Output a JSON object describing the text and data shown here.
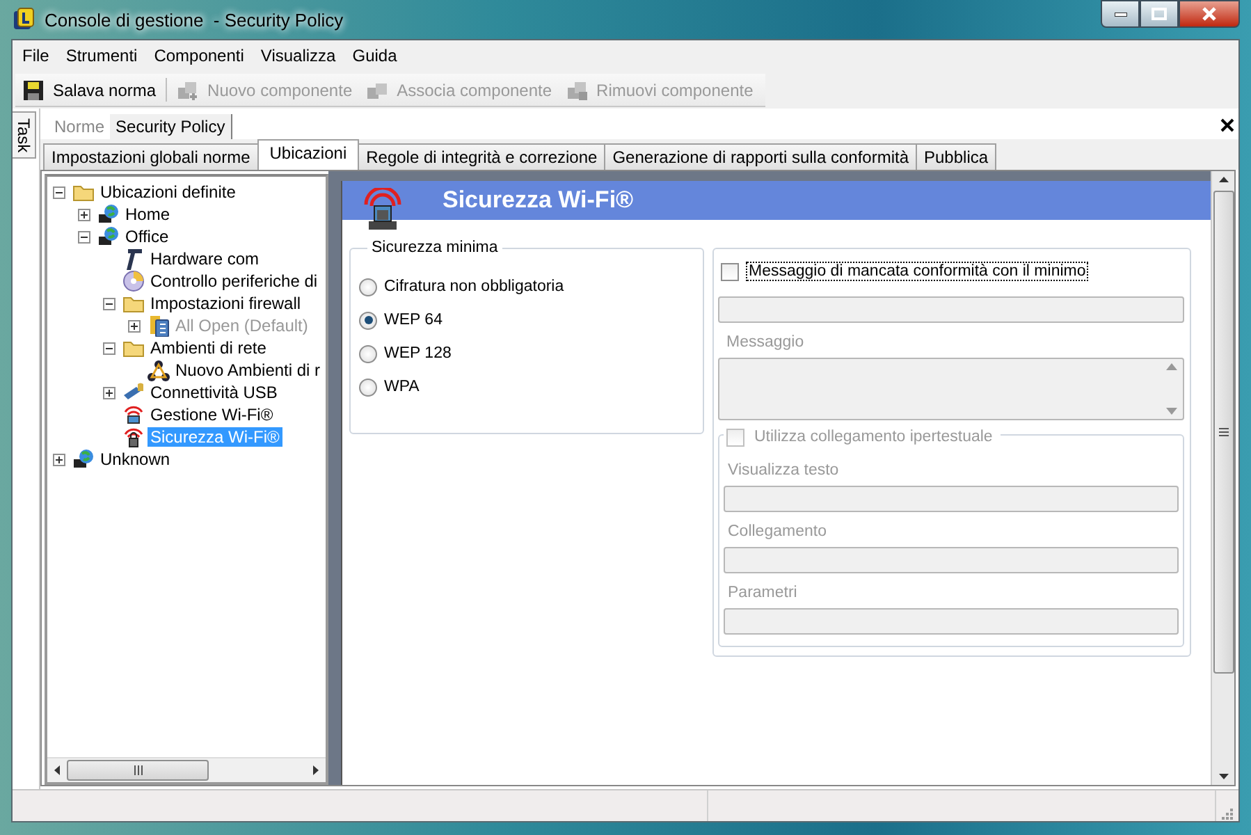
{
  "window": {
    "title": "Console di gestione  - Security Policy"
  },
  "menu": [
    "File",
    "Strumenti",
    "Componenti",
    "Visualizza",
    "Guida"
  ],
  "toolbar": [
    {
      "kind": "save",
      "label": "Salava norma",
      "disabled": false
    },
    {
      "kind": "new",
      "label": "Nuovo componente",
      "disabled": true
    },
    {
      "kind": "link",
      "label": "Associa componente",
      "disabled": true
    },
    {
      "kind": "remove",
      "label": "Rimuovi componente",
      "disabled": true
    }
  ],
  "side_tab": "Task",
  "doc_tabs": [
    {
      "label": "Norme",
      "selected": false
    },
    {
      "label": "Security Policy",
      "selected": true
    }
  ],
  "tabs": [
    {
      "label": "Impostazioni globali norme",
      "selected": false
    },
    {
      "label": "Ubicazioni",
      "selected": true
    },
    {
      "label": "Regole di integrità e correzione",
      "selected": false
    },
    {
      "label": "Generazione di rapporti sulla conformità",
      "selected": false
    },
    {
      "label": "Pubblica",
      "selected": false
    }
  ],
  "tree": [
    {
      "label": "Ubicazioni definite",
      "kind": "folder",
      "expanded": true,
      "selected": false,
      "disabled": false,
      "children": [
        {
          "label": "Home",
          "kind": "globe",
          "expanded": false,
          "selected": false,
          "disabled": false
        },
        {
          "label": "Office",
          "kind": "globe",
          "expanded": true,
          "selected": false,
          "disabled": false,
          "children": [
            {
              "label": "Hardware com",
              "kind": "hardware",
              "selected": false,
              "disabled": false
            },
            {
              "label": "Controllo periferiche di",
              "kind": "disc",
              "selected": false,
              "disabled": false
            },
            {
              "label": "Impostazioni firewall",
              "kind": "folder",
              "expanded": true,
              "selected": false,
              "disabled": false,
              "children": [
                {
                  "label": "All Open (Default)",
                  "kind": "firewall",
                  "expanded": false,
                  "selected": false,
                  "disabled": true
                }
              ]
            },
            {
              "label": "Ambienti di rete",
              "kind": "folder",
              "expanded": true,
              "selected": false,
              "disabled": false,
              "children": [
                {
                  "label": "Nuovo Ambienti di r",
                  "kind": "network",
                  "selected": false,
                  "disabled": false
                }
              ]
            },
            {
              "label": "Connettività USB",
              "kind": "usb",
              "expanded": false,
              "selected": false,
              "disabled": false
            },
            {
              "label": "Gestione Wi-Fi®",
              "kind": "wifi",
              "selected": false,
              "disabled": false
            },
            {
              "label": "Sicurezza Wi-Fi®",
              "kind": "wifilock",
              "selected": true,
              "disabled": false
            }
          ]
        }
      ]
    },
    {
      "label": "Unknown",
      "kind": "globe",
      "expanded": false,
      "selected": false,
      "disabled": false
    }
  ],
  "panel": {
    "title": "Sicurezza Wi-Fi®",
    "minimum": {
      "title": "Sicurezza minima",
      "options": [
        {
          "label": "Cifratura non obbligatoria",
          "selected": false
        },
        {
          "label": "WEP 64",
          "selected": true
        },
        {
          "label": "WEP 128",
          "selected": false
        },
        {
          "label": "WPA",
          "selected": false
        }
      ]
    },
    "message_checkbox": {
      "label": "Messaggio di mancata conformità con il minimo",
      "checked": false
    },
    "message_label": "Messaggio",
    "hyperlink": {
      "label": "Utilizza collegamento ipertestuale",
      "checked": false,
      "disabled": true,
      "fields": [
        {
          "label": "Visualizza testo"
        },
        {
          "label": "Collegamento"
        },
        {
          "label": "Parametri"
        }
      ]
    }
  }
}
